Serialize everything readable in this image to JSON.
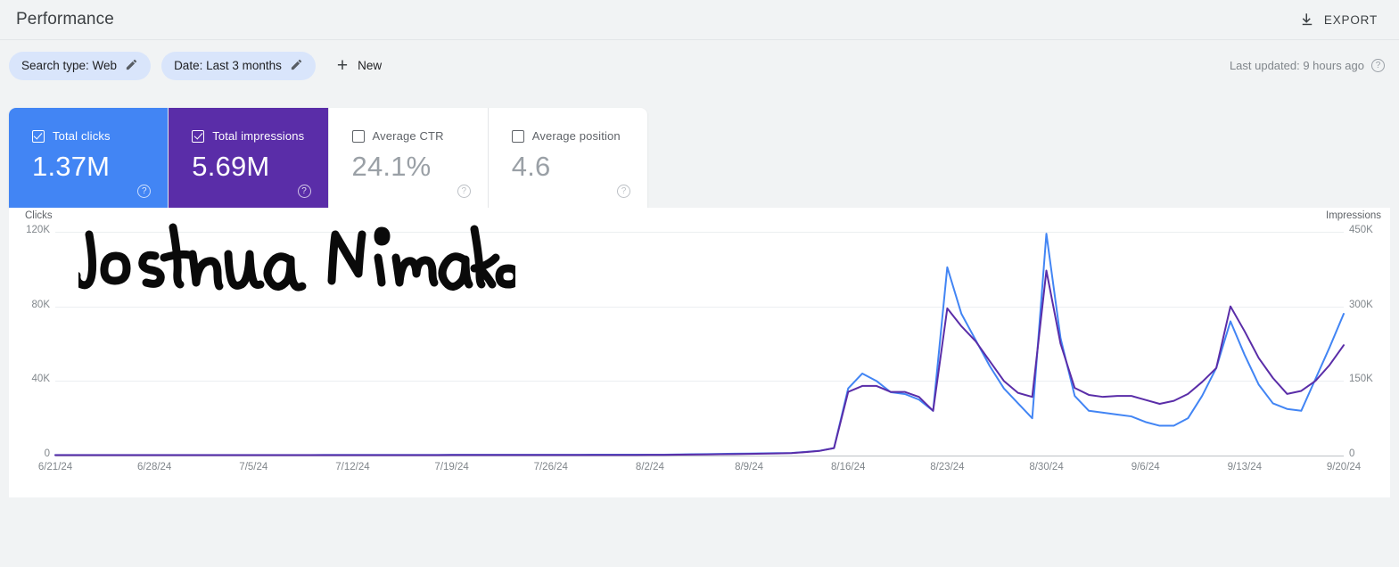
{
  "header": {
    "title": "Performance",
    "export_label": "EXPORT",
    "export_icon": "download-icon"
  },
  "filters": {
    "chips": [
      {
        "label": "Search type: Web",
        "icon": "pencil-icon"
      },
      {
        "label": "Date: Last 3 months",
        "icon": "pencil-icon"
      }
    ],
    "new_label": "New",
    "new_icon": "plus-icon",
    "last_updated": "Last updated: 9 hours ago",
    "help_icon": "question-mark-icon"
  },
  "metrics": [
    {
      "label": "Total clicks",
      "value": "1.37M",
      "selected": true,
      "color": "#4285f4",
      "help_icon": "question-mark-icon"
    },
    {
      "label": "Total impressions",
      "value": "5.69M",
      "selected": true,
      "color": "#5a2da8",
      "help_icon": "question-mark-icon"
    },
    {
      "label": "Average CTR",
      "value": "24.1%",
      "selected": false,
      "color": "#9aa0a6",
      "help_icon": "question-mark-icon"
    },
    {
      "label": "Average position",
      "value": "4.6",
      "selected": false,
      "color": "#9aa0a6",
      "help_icon": "question-mark-icon"
    }
  ],
  "annotation": {
    "text": "Joshua Nimako",
    "type": "handwritten-signature"
  },
  "chart_data": {
    "type": "line",
    "title": "",
    "xlabel": "",
    "grid": true,
    "legend": "none",
    "left_axis": {
      "label": "Clicks",
      "ticks": [
        "0",
        "40K",
        "80K",
        "120K"
      ],
      "ylim": [
        0,
        120000
      ],
      "color": "#4285f4"
    },
    "right_axis": {
      "label": "Impressions",
      "ticks": [
        "0",
        "150K",
        "300K",
        "450K"
      ],
      "ylim": [
        0,
        450000
      ],
      "color": "#5a2da8"
    },
    "xtick_labels": [
      "6/21/24",
      "6/28/24",
      "7/5/24",
      "7/12/24",
      "7/19/24",
      "7/26/24",
      "8/2/24",
      "8/9/24",
      "8/16/24",
      "8/23/24",
      "8/30/24",
      "9/6/24",
      "9/13/24",
      "9/20/24"
    ],
    "x": [
      "6/21/24",
      "6/22/24",
      "6/23/24",
      "6/24/24",
      "6/25/24",
      "6/26/24",
      "6/27/24",
      "6/28/24",
      "6/29/24",
      "6/30/24",
      "7/1/24",
      "7/2/24",
      "7/3/24",
      "7/4/24",
      "7/5/24",
      "7/6/24",
      "7/7/24",
      "7/8/24",
      "7/9/24",
      "7/10/24",
      "7/11/24",
      "7/12/24",
      "7/13/24",
      "7/14/24",
      "7/15/24",
      "7/16/24",
      "7/17/24",
      "7/18/24",
      "7/19/24",
      "7/20/24",
      "7/21/24",
      "7/22/24",
      "7/23/24",
      "7/24/24",
      "7/25/24",
      "7/26/24",
      "7/27/24",
      "7/28/24",
      "7/29/24",
      "7/30/24",
      "7/31/24",
      "8/1/24",
      "8/2/24",
      "8/3/24",
      "8/4/24",
      "8/5/24",
      "8/6/24",
      "8/7/24",
      "8/8/24",
      "8/9/24",
      "8/10/24",
      "8/11/24",
      "8/12/24",
      "8/13/24",
      "8/14/24",
      "8/15/24",
      "8/16/24",
      "8/17/24",
      "8/18/24",
      "8/19/24",
      "8/20/24",
      "8/21/24",
      "8/22/24",
      "8/23/24",
      "8/24/24",
      "8/25/24",
      "8/26/24",
      "8/27/24",
      "8/28/24",
      "8/29/24",
      "8/30/24",
      "8/31/24",
      "9/1/24",
      "9/2/24",
      "9/3/24",
      "9/4/24",
      "9/5/24",
      "9/6/24",
      "9/7/24",
      "9/8/24",
      "9/9/24",
      "9/10/24",
      "9/11/24",
      "9/12/24",
      "9/13/24",
      "9/14/24",
      "9/15/24",
      "9/16/24",
      "9/17/24",
      "9/18/24",
      "9/19/24",
      "9/20/24"
    ],
    "series": [
      {
        "name": "Clicks",
        "axis": "left",
        "color": "#4285f4",
        "values": [
          300,
          300,
          300,
          300,
          300,
          300,
          300,
          300,
          300,
          300,
          300,
          300,
          300,
          300,
          300,
          300,
          300,
          300,
          300,
          350,
          350,
          350,
          350,
          350,
          350,
          350,
          350,
          350,
          400,
          400,
          400,
          400,
          400,
          400,
          400,
          400,
          400,
          400,
          450,
          450,
          450,
          450,
          500,
          500,
          600,
          700,
          800,
          900,
          1000,
          1100,
          1200,
          1300,
          1400,
          2000,
          2600,
          4000,
          36000,
          44000,
          40000,
          34000,
          33000,
          30000,
          24000,
          101000,
          76000,
          62000,
          48000,
          36000,
          28000,
          20000,
          119000,
          63000,
          32000,
          24000,
          23000,
          22000,
          21000,
          18000,
          16000,
          16000,
          20000,
          32000,
          47000,
          72000,
          54000,
          38000,
          28000,
          25000,
          24000,
          41000,
          58000,
          76000
        ]
      },
      {
        "name": "Impressions",
        "axis": "right",
        "color": "#5a2da8",
        "values": [
          900,
          900,
          900,
          900,
          900,
          900,
          900,
          900,
          900,
          900,
          900,
          900,
          900,
          900,
          900,
          900,
          900,
          900,
          900,
          1000,
          1000,
          1000,
          1000,
          1000,
          1000,
          1000,
          1000,
          1000,
          1100,
          1100,
          1100,
          1100,
          1100,
          1100,
          1100,
          1100,
          1100,
          1100,
          1200,
          1200,
          1200,
          1200,
          1400,
          1400,
          1700,
          2000,
          2300,
          2600,
          3000,
          3400,
          3800,
          4300,
          4900,
          7000,
          9500,
          15000,
          128000,
          140000,
          140000,
          128000,
          128000,
          118000,
          90000,
          296000,
          260000,
          230000,
          190000,
          150000,
          126000,
          118000,
          372000,
          225000,
          136000,
          122000,
          118000,
          120000,
          120000,
          112000,
          104000,
          110000,
          124000,
          148000,
          176000,
          300000,
          250000,
          196000,
          156000,
          124000,
          130000,
          150000,
          182000,
          222000
        ]
      }
    ]
  }
}
